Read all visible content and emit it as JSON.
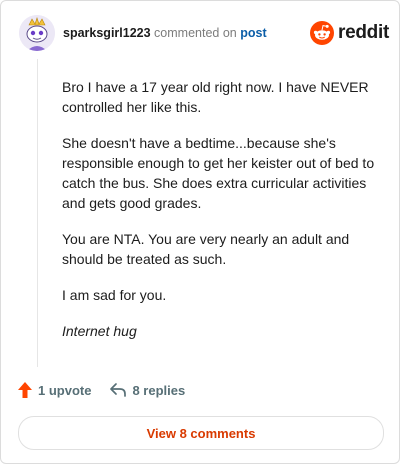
{
  "header": {
    "username": "sparksgirl1223",
    "action_text": "commented on",
    "post_link": "post",
    "logo_text": "reddit"
  },
  "comment": {
    "paragraphs": [
      "Bro I have a 17 year old right now. I have NEVER controlled her like this.",
      "She doesn't have a bedtime...because she's responsible enough to get her keister out of bed to catch the bus. She does extra curricular activities and gets good grades.",
      "You are NTA. You are very nearly an adult and should be treated as such.",
      "I am sad for you.",
      "Internet hug"
    ]
  },
  "actions": {
    "upvote_label": "1 upvote",
    "replies_label": "8 replies"
  },
  "footer": {
    "view_comments_label": "View 8 comments"
  },
  "colors": {
    "reddit_orange": "#ff4500",
    "link_blue": "#0b5ea8",
    "view_button_text": "#d93a00",
    "action_gray": "#576f76"
  },
  "icons": [
    "avatar-snoo-icon",
    "reddit-snoo-icon",
    "upvote-arrow-icon",
    "reply-arrow-icon"
  ]
}
